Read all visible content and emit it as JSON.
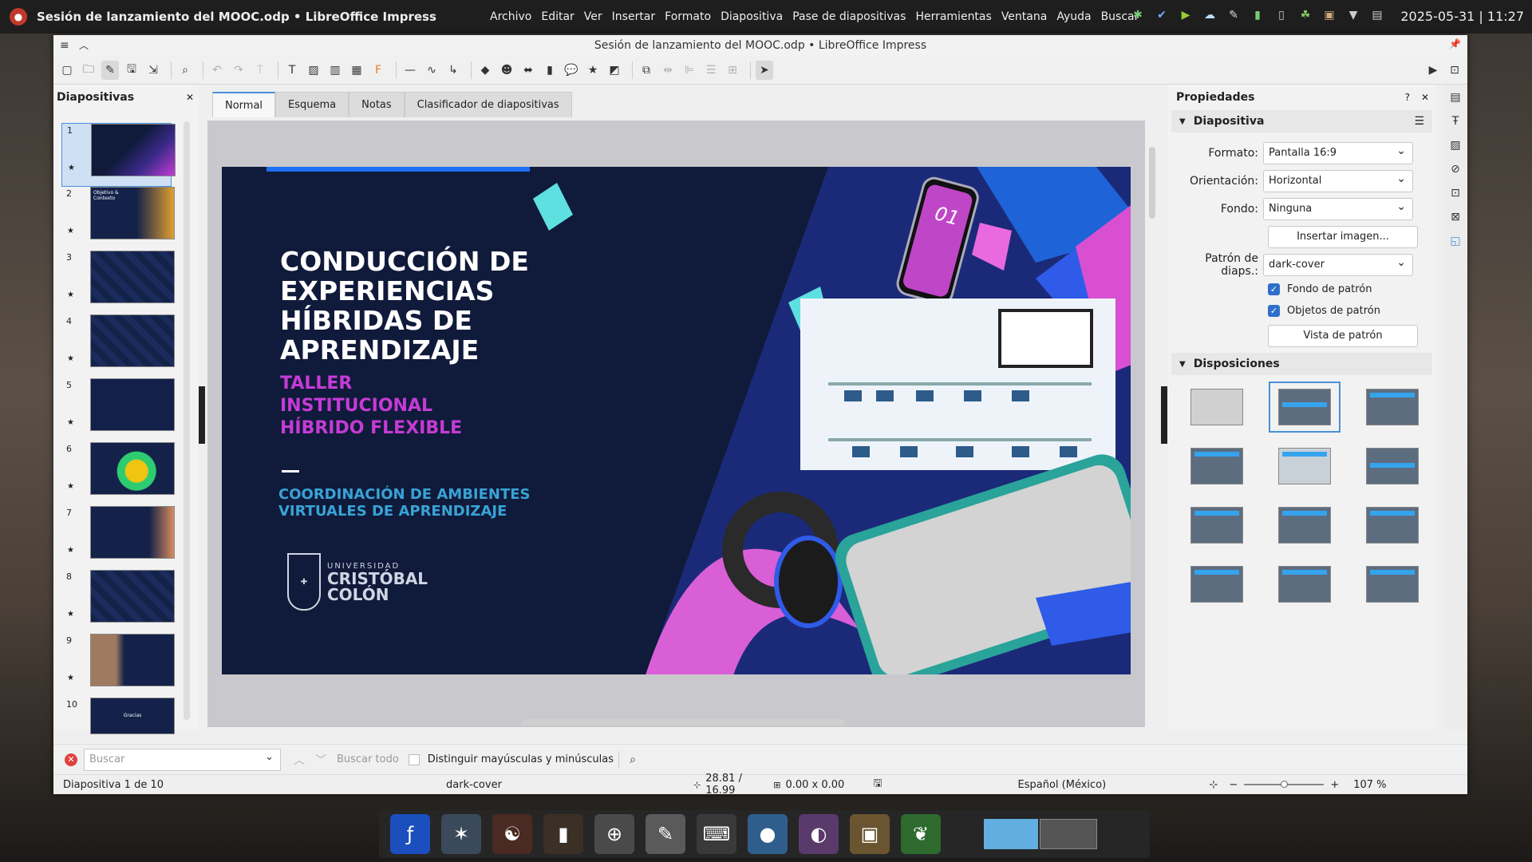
{
  "topbar": {
    "app_title": "Sesión de lanzamiento del MOOC.odp • LibreOffice Impress",
    "menu": [
      "Archivo",
      "Editar",
      "Ver",
      "Insertar",
      "Formato",
      "Diapositiva",
      "Pase de diapositivas",
      "Herramientas",
      "Ventana",
      "Ayuda",
      "Buscar"
    ],
    "clock": "2025-05-31 | 11:27"
  },
  "window": {
    "title": "Sesión de lanzamiento del MOOC.odp • LibreOffice Impress"
  },
  "left_pane": {
    "title": "Diapositivas",
    "slides": [
      {
        "num": "1",
        "label": ""
      },
      {
        "num": "2",
        "label": "Objetivo & Contexto"
      },
      {
        "num": "3",
        "label": ""
      },
      {
        "num": "4",
        "label": ""
      },
      {
        "num": "5",
        "label": ""
      },
      {
        "num": "6",
        "label": ""
      },
      {
        "num": "7",
        "label": ""
      },
      {
        "num": "8",
        "label": ""
      },
      {
        "num": "9",
        "label": ""
      },
      {
        "num": "10",
        "label": "Gracias"
      }
    ]
  },
  "tabs": [
    "Normal",
    "Esquema",
    "Notas",
    "Clasificador de diapositivas"
  ],
  "slide": {
    "title": "CONDUCCIÓN DE EXPERIENCIAS HÍBRIDAS DE APRENDIZAJE",
    "subtitle": "TALLER INSTITUCIONAL HÍBRIDO FLEXIBLE",
    "org": "COORDINACIÓN DE AMBIENTES VIRTUALES DE APRENDIZAJE",
    "logo_small": "UNIVERSIDAD",
    "logo_big1": "CRISTÓBAL",
    "logo_big2": "COLÓN",
    "phone_label": "01"
  },
  "sidebar": {
    "title": "Propiedades",
    "section_slide": "Diapositiva",
    "format_label": "Formato:",
    "format_value": "Pantalla 16:9",
    "orientation_label": "Orientación:",
    "orientation_value": "Horizontal",
    "background_label": "Fondo:",
    "background_value": "Ninguna",
    "insert_image": "Insertar imagen...",
    "master_label": "Patrón de diaps.:",
    "master_value": "dark-cover",
    "chk_master_bg": "Fondo de patrón",
    "chk_master_obj": "Objetos de patrón",
    "master_view": "Vista de patrón",
    "section_layouts": "Disposiciones"
  },
  "findbar": {
    "placeholder": "Buscar",
    "find_all": "Buscar todo",
    "match_case": "Distinguir mayúsculas y minúsculas"
  },
  "status": {
    "slide_pos": "Diapositiva 1 de 10",
    "master": "dark-cover",
    "position": "28.81 / 16.99",
    "size": "0.00 x 0.00",
    "language": "Español (México)",
    "zoom": "107 %"
  },
  "colors": {
    "accent": "#4a8fd8",
    "slide_bg": "#101a3a",
    "subtitle": "#c53bd6",
    "org": "#38a3d6"
  }
}
